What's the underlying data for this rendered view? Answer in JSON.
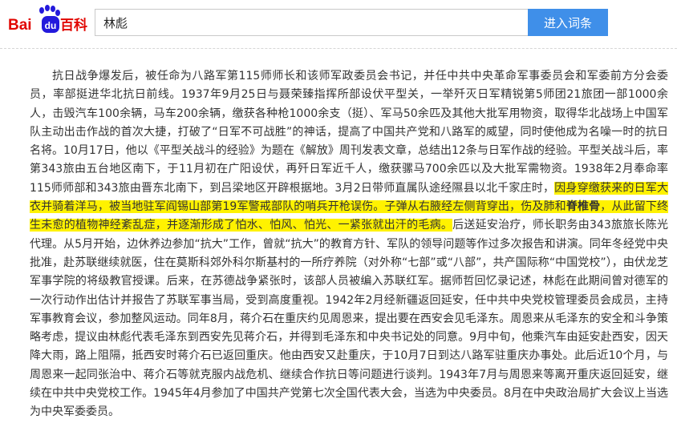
{
  "header": {
    "logo_text": "Baidu百科",
    "search_value": "林彪",
    "search_button": "进入词条"
  },
  "colors": {
    "logo_red": "#e10601",
    "logo_blue": "#2319dc",
    "button_blue": "#3f8fe9",
    "highlight": "#fff200"
  },
  "article": {
    "s1": "抗日战争爆发后，被任命为八路军第115师师长和该师军政委员会书记，并任中共中央革命军事委员会和军委前方分会委员，率部挺进华北抗日前线。1937年9月25日与聂荣臻指挥所部设伏平型关，一举歼灭日军精锐第5师团21旅团一部1000余人，击毁汽车100余辆，马车200余辆，缴获各种枪1000余支（挺）、军马50余匹及其他大批军用物资，取得华北战场上中国军队主动出击作战的首次大捷，打破了“日军不可战胜”的神话，提高了中国共产党和八路军的威望，同时使他成为名噪一时的抗日名将。10月17日，他以《平型关战斗的经验》为题在《解放》周刊发表文章，总结出12条与日军作战的经验。平型关战斗后，率第343旅由五台地区南下，于11月初在广阳设伏，再歼日军近千人，缴获骡马700余匹以及大批军需物资。1938年2月奉命率115师师部和343旅由晋东北南下，到吕梁地区开辟根据地。3月2日带师直属队途经隰县以北千家庄时，",
    "h1": "因身穿缴获来的日军大衣并骑着洋马，被当地驻军阎锡山部第19军警戒部队的哨兵开枪误伤。子弹从右腋经左侧背穿出，伤及肺和",
    "h2": "脊椎骨",
    "h3": "，从此留下终生未愈的植物神经紊乱症，并逐渐形成了怕水、怕风、怕光、一紧张就出汗的毛病。",
    "s2": "后送延安治疗，师长职务由343旅旅长陈光代理。从5月开始，边休养边参加“抗大”工作，曾就“抗大”的教育方针、军队的领导问题等作过多次报告和讲演。同年冬经党中央批准，赴苏联继续就医，住在莫斯科郊外科尔斯基村的一所疗养院（对外称“七部”或“八部”，共产国际称“中国党校”），由伏龙芝军事学院的将级教官授课。后来，在苏德战争紧张时，该部人员被编入苏联红军。据师哲回忆录记述，林彪在此期间曾对德军的一次行动作出估计并报告了苏联军事当局，受到高度重视。1942年2月经新疆返回延安，任中共中央党校管理委员会成员，主持军事教育会议，参加整风运动。同年8月，蒋介石在重庆约见周恩来，提出要在西安会见毛泽东。周恩来从毛泽东的安全和斗争策略考虑，提议由林彪代表毛泽东到西安先见蒋介石，并得到毛泽东和中央书记处的同意。9月中旬，他乘汽车由延安赴西安，因天降大雨，路上阻隔，抵西安时蒋介石已返回重庆。他由西安又赴重庆，于10月7日到达八路军驻重庆办事处。此后近10个月，与周恩来一起同张治中、蒋介石等就克服内战危机、继续合作抗日等问题进行谈判。1943年7月与周恩来等离开重庆返回延安，继续在中共中央党校工作。1945年4月参加了中国共产党第七次全国代表大会，当选为中央委员。8月在中央政治局扩大会议上当选为中央军委委员。"
  }
}
